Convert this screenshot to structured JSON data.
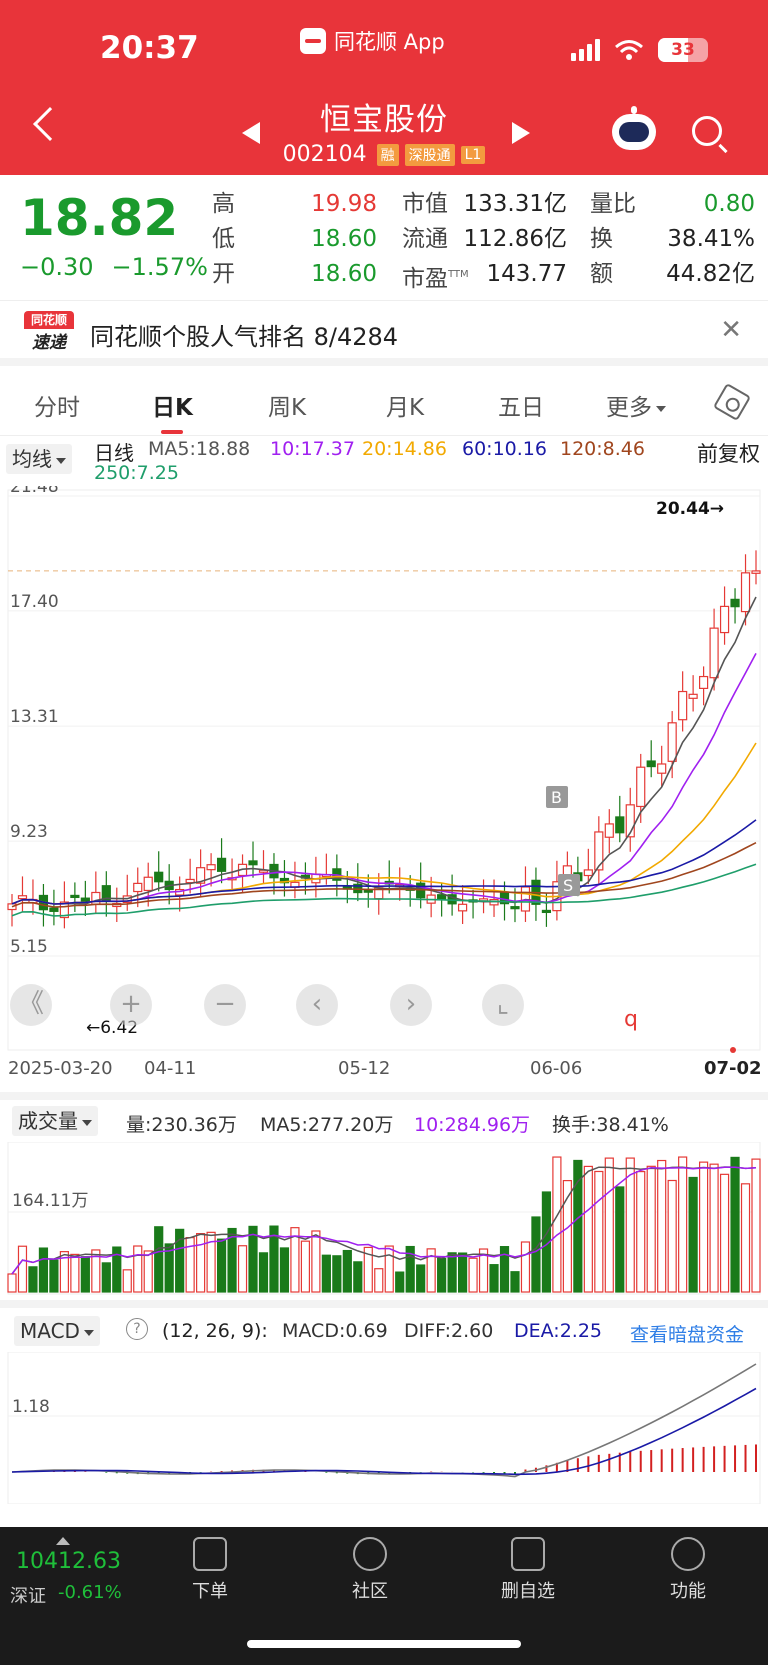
{
  "status": {
    "time": "20:37",
    "app": "同花顺 App",
    "battery": "33"
  },
  "stock": {
    "name": "恒宝股份",
    "code": "002104",
    "tags": [
      "融",
      "深股通",
      "L1"
    ]
  },
  "quote": {
    "price": "18.82",
    "change": "−0.30",
    "change_pct": "−1.57%",
    "high_label": "高",
    "high": "19.98",
    "low_label": "低",
    "low": "18.60",
    "open_label": "开",
    "open": "18.60",
    "mcap_label": "市值",
    "mcap": "133.31亿",
    "float_label": "流通",
    "float": "112.86亿",
    "pe_label": "市盈",
    "pe_sup": "TTM",
    "pe": "143.77",
    "vr_label": "量比",
    "vr": "0.80",
    "turnover_label": "换",
    "turnover": "38.41%",
    "amount_label": "额",
    "amount": "44.82亿"
  },
  "news": {
    "logo_top": "同花顺",
    "logo_bottom": "速递",
    "text": "同花顺个股人气排名 8/4284"
  },
  "tabs": [
    {
      "label": "分时"
    },
    {
      "label": "日K"
    },
    {
      "label": "周K"
    },
    {
      "label": "月K"
    },
    {
      "label": "五日"
    },
    {
      "label": "更多"
    }
  ],
  "ma": {
    "selector": "均线",
    "period": "日线",
    "ma5": "MA5:18.88",
    "ma10": "10:17.37",
    "ma20": "20:14.86",
    "ma60": "60:10.16",
    "ma120": "120:8.46",
    "ma250": "250:7.25",
    "adjust": "前复权",
    "colors": {
      "ma5": "#555555",
      "ma10": "#a020f0",
      "ma20": "#f2a900",
      "ma60": "#1a1aa6",
      "ma120": "#a0461e",
      "ma250": "#1f9e6b"
    }
  },
  "kline": {
    "y_ticks": [
      "21.48",
      "17.40",
      "13.31",
      "9.23",
      "5.15"
    ],
    "y_tick_values": [
      21.48,
      17.4,
      13.31,
      9.23,
      5.15
    ],
    "high_marker": "20.44→",
    "low_marker": "←6.42",
    "current_price": 18.82,
    "buy_label": "B",
    "sell_label": "S",
    "q_label": "q"
  },
  "dates": [
    "2025-03-20",
    "04-11",
    "05-12",
    "06-06",
    "07-02"
  ],
  "toolbar": {
    "back": "《",
    "zoom_in": "+",
    "zoom_out": "−",
    "prev": "‹",
    "next": "›"
  },
  "volume": {
    "selector": "成交量",
    "vol": "量:230.36万",
    "ma5": "MA5:277.20万",
    "ma10": "10:284.96万",
    "turnover": "换手:38.41%",
    "y_tick": "164.11万"
  },
  "macd": {
    "selector": "MACD",
    "help": "?",
    "params": "(12, 26, 9):",
    "macd": "MACD:0.69",
    "diff": "DIFF:2.60",
    "dea": "DEA:2.25",
    "link": "查看暗盘资金",
    "y_tick": "1.18"
  },
  "bottom": {
    "index_value": "10412.63",
    "index_name": "深证",
    "index_change": "-0.61%",
    "nav": [
      {
        "label": "下单"
      },
      {
        "label": "社区"
      },
      {
        "label": "删自选"
      },
      {
        "label": "功能"
      }
    ]
  }
}
